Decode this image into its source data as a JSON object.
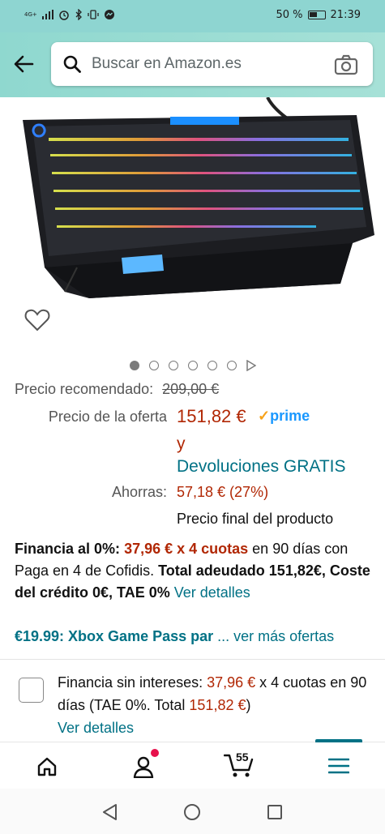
{
  "status": {
    "network": "4G+",
    "battery": "50 %",
    "time": "21:39"
  },
  "search": {
    "placeholder": "Buscar en Amazon.es"
  },
  "icons": {
    "back": "arrow-left-icon",
    "search": "magnifier-icon",
    "camera": "camera-icon",
    "wishlist": "heart-outline-icon",
    "home": "home-icon",
    "account": "person-icon",
    "cart": "cart-icon",
    "menu": "hamburger-icon"
  },
  "carousel": {
    "count": 6,
    "active": 0
  },
  "price": {
    "recommended_label": "Precio recomendado:",
    "recommended_value": "209,00 €",
    "offer_label": "Precio de la oferta",
    "offer_value": "151,82 €",
    "prime_check": "✓",
    "prime_text": "prime",
    "and": "y",
    "returns": "Devoluciones GRATIS",
    "savings_label": "Ahorras:",
    "savings_value": "57,18 € (27%)",
    "final_note": "Precio final del producto"
  },
  "financing": {
    "lead": "Financia al 0%:",
    "amount": "37,96 € x 4 cuotas",
    "mid": " en 90 días con Paga en 4 de Cofidis. ",
    "total": "Total adeudado 151,82€, Coste del crédito 0€, TAE 0%",
    "details_link": " Ver detalles"
  },
  "offer": {
    "xbox": "€19.99: Xbox Game Pass par",
    "more": " ... ver más ofertas"
  },
  "installments": {
    "lead": "Financia sin intereses: ",
    "amount": "37,96 €",
    "mid": " x 4 cuotas en 90 días (TAE 0%. Total ",
    "total": "151,82 €",
    "end": ")",
    "details_link": "Ver detalles"
  },
  "cart": {
    "count": "55"
  },
  "colors": {
    "header": "#8fd8cf",
    "price_red": "#b12704",
    "link_teal": "#007185",
    "prime_blue": "#1a98ff",
    "badge_red": "#e7114c"
  }
}
